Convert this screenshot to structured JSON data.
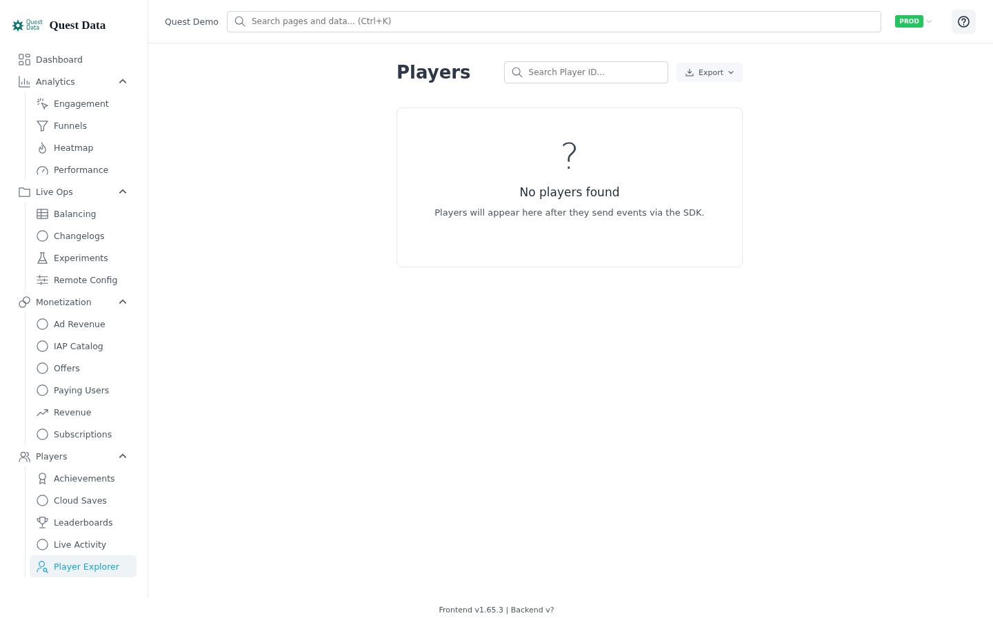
{
  "brand": {
    "logo_text": [
      "Quest",
      "Data"
    ],
    "name": "Quest Data"
  },
  "sidebar": {
    "items": [
      {
        "label": "Dashboard",
        "selected": false
      },
      {
        "label": "Analytics",
        "expanded": true,
        "children": [
          {
            "label": "Engagement",
            "selected": false
          },
          {
            "label": "Funnels",
            "selected": false
          },
          {
            "label": "Heatmap",
            "selected": false
          },
          {
            "label": "Performance",
            "selected": false
          }
        ]
      },
      {
        "label": "Live Ops",
        "expanded": true,
        "children": [
          {
            "label": "Balancing",
            "selected": false
          },
          {
            "label": "Changelogs",
            "selected": false
          },
          {
            "label": "Experiments",
            "selected": false
          },
          {
            "label": "Remote Config",
            "selected": false
          }
        ]
      },
      {
        "label": "Monetization",
        "expanded": true,
        "children": [
          {
            "label": "Ad Revenue",
            "selected": false
          },
          {
            "label": "IAP Catalog",
            "selected": false
          },
          {
            "label": "Offers",
            "selected": false
          },
          {
            "label": "Paying Users",
            "selected": false
          },
          {
            "label": "Revenue",
            "selected": false
          },
          {
            "label": "Subscriptions",
            "selected": false
          }
        ]
      },
      {
        "label": "Players",
        "expanded": true,
        "children": [
          {
            "label": "Achievements",
            "selected": false
          },
          {
            "label": "Cloud Saves",
            "selected": false
          },
          {
            "label": "Leaderboards",
            "selected": false
          },
          {
            "label": "Live Activity",
            "selected": false
          },
          {
            "label": "Player Explorer",
            "selected": true
          }
        ]
      }
    ]
  },
  "header": {
    "project": "Quest Demo",
    "search": {
      "placeholder": "Search pages and data... (Ctrl+K)"
    },
    "environment": "PROD"
  },
  "page": {
    "title": "Players",
    "search": {
      "placeholder": "Search Player ID..."
    },
    "export_button": "Export",
    "empty_state": {
      "symbol": "?",
      "title": "No players found",
      "message": "Players will appear here after they send events via the SDK."
    }
  },
  "footer": "Frontend v1.65.3 | Backend v?"
}
